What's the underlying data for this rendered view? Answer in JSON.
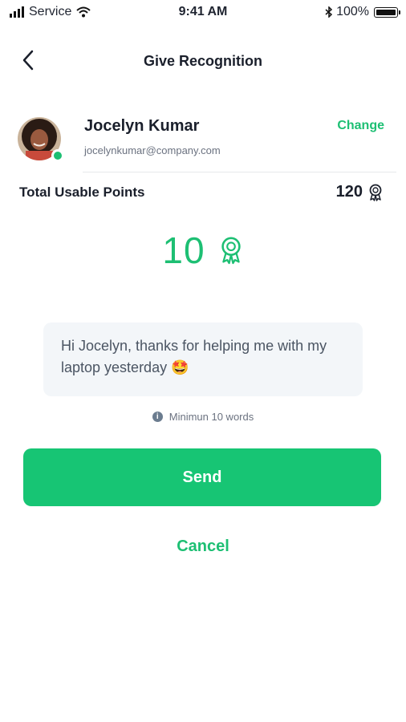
{
  "status_bar": {
    "carrier": "Service",
    "time": "9:41 AM",
    "battery": "100%",
    "icons": [
      "signal-icon",
      "wifi-icon",
      "bluetooth-icon",
      "battery-icon"
    ]
  },
  "header": {
    "title": "Give Recognition",
    "back_icon": "chevron-left-icon"
  },
  "recipient": {
    "name": "Jocelyn Kumar",
    "email": "jocelynkumar@company.com",
    "change_label": "Change",
    "online": true
  },
  "points": {
    "label": "Total Usable Points",
    "value": "120",
    "icon": "award-ribbon-icon"
  },
  "selected": {
    "value": "10",
    "icon": "award-ribbon-icon"
  },
  "message": {
    "text": "Hi Jocelyn, thanks for helping me with my laptop yesterday 🤩"
  },
  "hint": {
    "text": "Minimun 10 words",
    "icon": "info-icon"
  },
  "actions": {
    "send_label": "Send",
    "cancel_label": "Cancel"
  },
  "colors": {
    "accent": "#1dbf73",
    "button": "#17c574",
    "message_bg": "#f3f6f9"
  }
}
